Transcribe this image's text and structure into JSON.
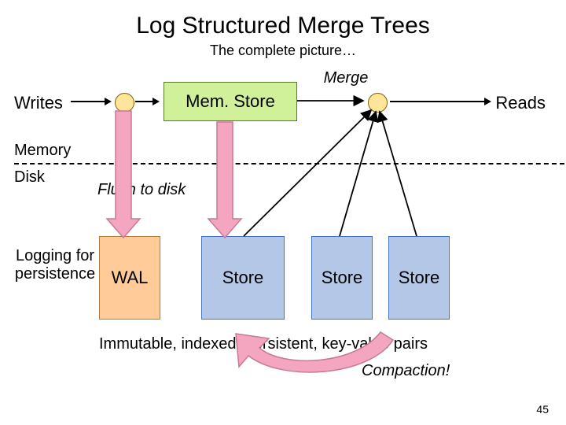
{
  "title": "Log Structured Merge Trees",
  "subtitle": "The complete picture…",
  "labels": {
    "merge": "Merge",
    "writes": "Writes",
    "reads": "Reads",
    "memory": "Memory",
    "disk": "Disk",
    "flush": "Flush to disk",
    "logging": "Logging for persistence",
    "immutable": "Immutable, indexed, persistent, key-value pairs",
    "compaction": "Compaction!"
  },
  "boxes": {
    "memstore": "Mem. Store",
    "wal": "WAL",
    "store1": "Store",
    "store2": "Store",
    "store3": "Store"
  },
  "page": "45"
}
